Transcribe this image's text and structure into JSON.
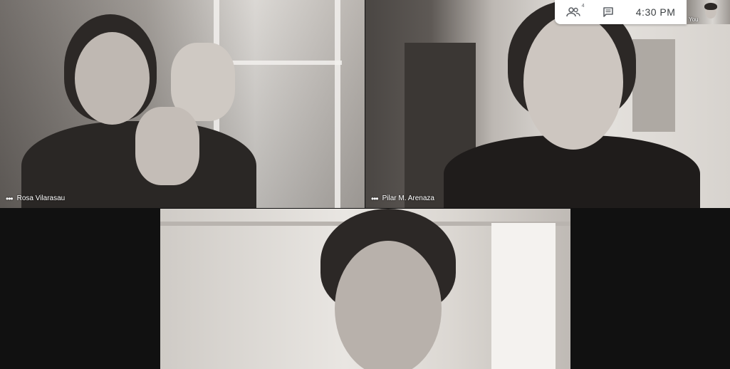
{
  "participants": [
    {
      "name": "Rosa Vilarasau"
    },
    {
      "name": "Pilar M. Arenaza"
    }
  ],
  "main_speaker": {
    "name": ""
  },
  "top_bar": {
    "people_icon": "people-icon",
    "people_count": "4",
    "chat_icon": "chat-icon",
    "time": "4:30 PM"
  },
  "self_view": {
    "label": "You"
  },
  "participant_menu_icon": "more-dots-icon"
}
